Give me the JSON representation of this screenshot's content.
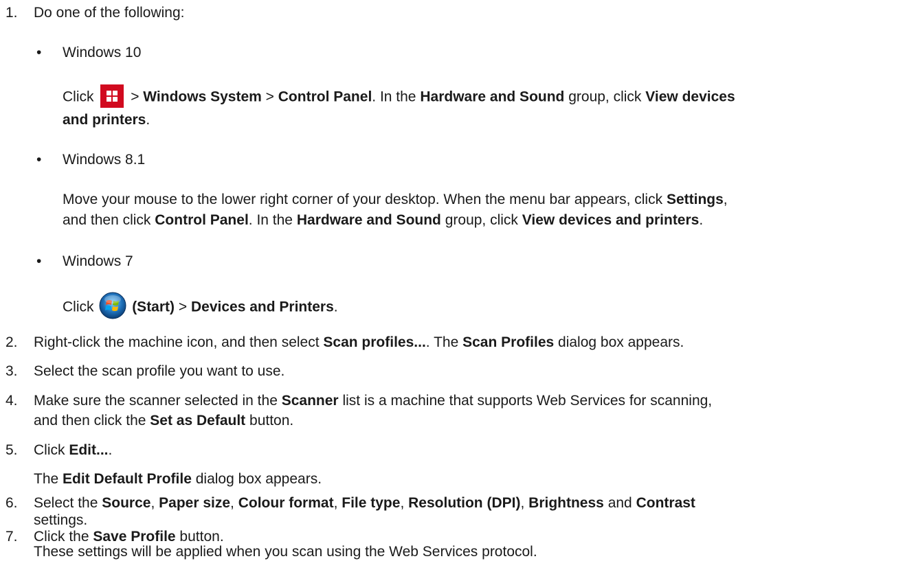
{
  "colors": {
    "text": "#1a1a1a",
    "windows10_icon_bg": "#d10a1f"
  },
  "icons": {
    "windows10_start": "windows-logo-icon",
    "windows7_start": "windows7-start-orb-icon"
  },
  "step1": {
    "num": "1.",
    "text": "Do one of the following:"
  },
  "win10": {
    "bullet": "•",
    "title": "Windows 10",
    "click": "Click",
    "sep1": ">",
    "windows_system": "Windows System",
    "sep2": ">",
    "control_panel": "Control Panel",
    "period1": ". In the",
    "hardware_sound": "Hardware and Sound",
    "group_click": "group, click",
    "view_devices": "View devices",
    "and_printers": "and printers",
    "period2": "."
  },
  "win81": {
    "bullet": "•",
    "title": "Windows 8.1",
    "text1": "Move your mouse to the lower right corner of your desktop. When the menu bar appears, click",
    "settings": "Settings",
    "comma": ",",
    "text2": "and then click",
    "control_panel": "Control Panel",
    "text3": ". In the",
    "hardware_sound": "Hardware and Sound",
    "text4": "group, click",
    "view_devices": "View devices and printers",
    "period": "."
  },
  "win7": {
    "bullet": "•",
    "title": "Windows 7",
    "click": "Click",
    "start": "(Start)",
    "sep": ">",
    "devices_printers": "Devices and Printers",
    "period": "."
  },
  "step2": {
    "num": "2.",
    "text1": "Right-click the machine icon, and then select",
    "scan_profiles_menu": "Scan profiles...",
    "text2": ". The",
    "scan_profiles_dialog": "Scan Profiles",
    "text3": "dialog box appears."
  },
  "step3": {
    "num": "3.",
    "text": "Select the scan profile you want to use."
  },
  "step4": {
    "num": "4.",
    "text1": "Make sure the scanner selected in the",
    "scanner": "Scanner",
    "text2": "list is a machine that supports Web Services for scanning,",
    "text3": "and then click the",
    "set_default": "Set as Default",
    "text4": "button."
  },
  "step5": {
    "num": "5.",
    "click": "Click",
    "edit": "Edit...",
    "period": ".",
    "text1": "The",
    "edit_default_profile": "Edit Default Profile",
    "text2": "dialog box appears."
  },
  "step6": {
    "num": "6.",
    "text1": "Select the",
    "source": "Source",
    "c1": ",",
    "paper_size": "Paper size",
    "c2": ",",
    "colour_format": "Colour format",
    "c3": ",",
    "file_type": "File type",
    "c4": ",",
    "resolution": "Resolution (DPI)",
    "c5": ",",
    "brightness": "Brightness",
    "and": "and",
    "contrast": "Contrast",
    "text2": "settings."
  },
  "step7": {
    "num": "7.",
    "text1": "Click the",
    "save_profile": "Save Profile",
    "text2": "button.",
    "result": "These settings will be applied when you scan using the Web Services protocol."
  }
}
